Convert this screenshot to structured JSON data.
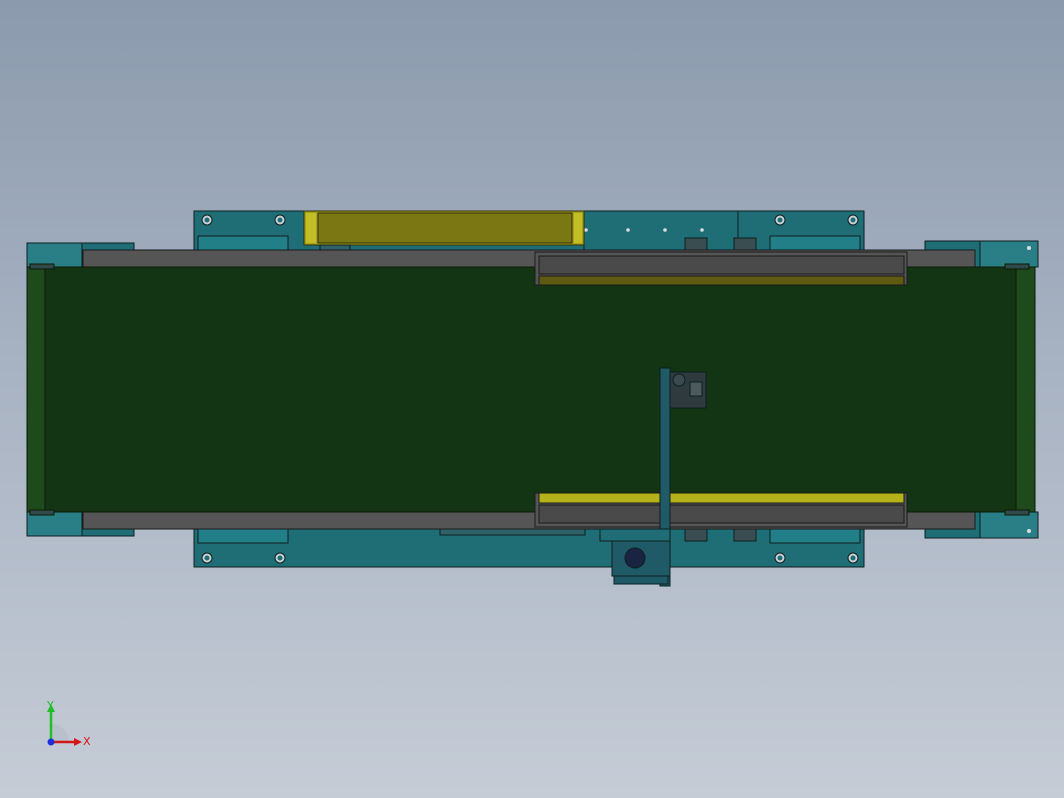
{
  "viewport": {
    "background_top": "#8b9aad",
    "background_bottom": "#c5ccd6"
  },
  "model": {
    "frame_color": "#1f6e75",
    "belt_color": "#143513",
    "rail_color": "#555555",
    "guard_color": "#b5b31a",
    "edge_color": "#0c1f22"
  },
  "triad": {
    "y_label": "Y",
    "x_label": "X",
    "y_color": "#1fbf2a",
    "x_color": "#d4151b",
    "z_color": "#1c2fd8"
  }
}
